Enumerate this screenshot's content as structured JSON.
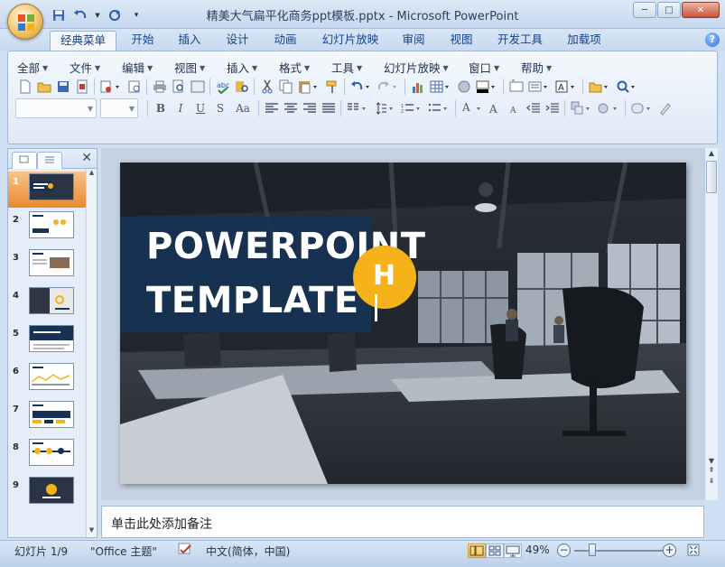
{
  "window": {
    "title": "精美大气扁平化商务ppt模板.pptx - Microsoft PowerPoint",
    "min_label": "─",
    "max_label": "□",
    "close_label": "✕"
  },
  "ribbon_tabs": [
    "经典菜单",
    "开始",
    "插入",
    "设计",
    "动画",
    "幻灯片放映",
    "审阅",
    "视图",
    "开发工具",
    "加载项"
  ],
  "active_tab_index": 0,
  "menu_bar": [
    "全部",
    "文件",
    "编辑",
    "视图",
    "插入",
    "格式",
    "工具",
    "幻灯片放映",
    "窗口",
    "帮助"
  ],
  "format_buttons": [
    "B",
    "I",
    "U",
    "S",
    "Aa"
  ],
  "slides_pane": {
    "close_label": "✕",
    "slide_numbers": [
      "1",
      "2",
      "3",
      "4",
      "5",
      "6",
      "7",
      "8",
      "9"
    ],
    "selected_index": 0
  },
  "slide": {
    "line1": "POWERPOINT",
    "line2": "TEMPLATE",
    "badge_text": "H",
    "badge_color": "#f6b21b",
    "title_block_color": "#173254"
  },
  "notes_placeholder": "单击此处添加备注",
  "status": {
    "slide_counter": "幻灯片 1/9",
    "theme": "\"Office 主题\"",
    "language": "中文(简体，中国)",
    "zoom": "49%",
    "zoom_minus": "−",
    "zoom_plus": "+"
  },
  "colors": {
    "accent_orange": "#f6b21b",
    "selection_orange": "#e98a2e",
    "ribbon_blue": "#15428b"
  }
}
